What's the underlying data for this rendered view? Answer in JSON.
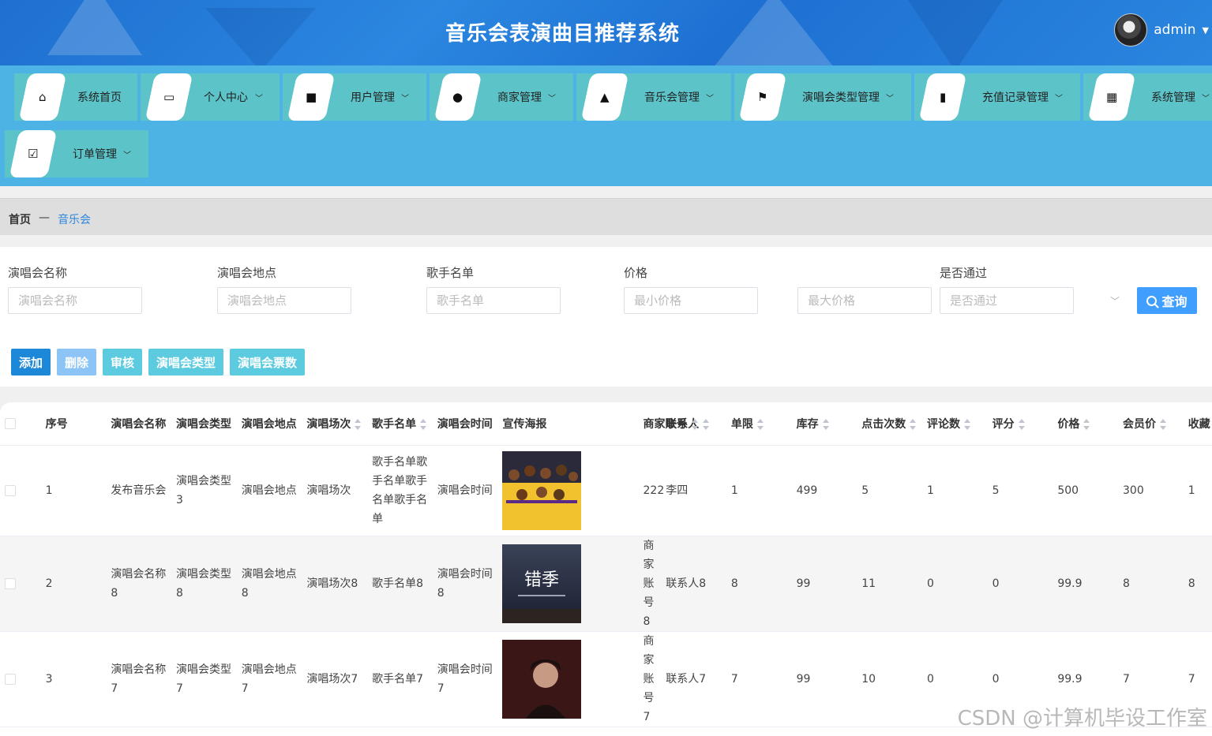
{
  "header": {
    "title": "音乐会表演曲目推荐系统",
    "user": "admin"
  },
  "nav": [
    {
      "label": "系统首页",
      "icon": "home-icon",
      "dropdown": false
    },
    {
      "label": "个人中心",
      "icon": "wallet-icon",
      "dropdown": true
    },
    {
      "label": "用户管理",
      "icon": "robot-icon",
      "dropdown": true
    },
    {
      "label": "商家管理",
      "icon": "user-icon",
      "dropdown": true
    },
    {
      "label": "音乐会管理",
      "icon": "person-icon",
      "dropdown": true
    },
    {
      "label": "演唱会类型管理",
      "icon": "flag-icon",
      "dropdown": true
    },
    {
      "label": "充值记录管理",
      "icon": "bar-chart-icon",
      "dropdown": true
    },
    {
      "label": "系统管理",
      "icon": "grid-icon",
      "dropdown": true
    },
    {
      "label": "订单管理",
      "icon": "clipboard-icon",
      "dropdown": true
    }
  ],
  "breadcrumb": {
    "home": "首页",
    "sep": "—",
    "current": "音乐会"
  },
  "search": {
    "name_label": "演唱会名称",
    "name_placeholder": "演唱会名称",
    "place_label": "演唱会地点",
    "place_placeholder": "演唱会地点",
    "singer_label": "歌手名单",
    "singer_placeholder": "歌手名单",
    "price_label": "价格",
    "min_price_placeholder": "最小价格",
    "max_price_placeholder": "最大价格",
    "pass_label": "是否通过",
    "pass_placeholder": "是否通过",
    "button": "查询"
  },
  "actions": [
    "添加",
    "删除",
    "审核",
    "演唱会类型",
    "演唱会票数"
  ],
  "table": {
    "columns": [
      "序号",
      "演唱会名称",
      "演唱会类型",
      "演唱会地点",
      "演唱场次",
      "歌手名单",
      "演唱会时间",
      "宣传海报",
      "商家账号",
      "联系人",
      "单限",
      "库存",
      "点击次数",
      "评论数",
      "评分",
      "价格",
      "会员价",
      "收藏"
    ],
    "rows": [
      [
        "1",
        "发布音乐会",
        "演唱会类型3",
        "演唱会地点",
        "演唱场次",
        "歌手名单歌手名单歌手名单歌手名单",
        "演唱会时间",
        "",
        "222",
        "李四",
        "1",
        "499",
        "5",
        "1",
        "5",
        "500",
        "300",
        "1"
      ],
      [
        "2",
        "演唱会名称8",
        "演唱会类型8",
        "演唱会地点8",
        "演唱场次8",
        "歌手名单8",
        "演唱会时间8",
        "",
        "商家账号8",
        "联系人8",
        "8",
        "99",
        "11",
        "0",
        "0",
        "99.9",
        "8",
        "8"
      ],
      [
        "3",
        "演唱会名称7",
        "演唱会类型7",
        "演唱会地点7",
        "演唱场次7",
        "歌手名单7",
        "演唱会时间7",
        "",
        "商家账号7",
        "联系人7",
        "7",
        "99",
        "10",
        "0",
        "0",
        "99.9",
        "7",
        "7"
      ]
    ],
    "poster_text": {
      "row2": "错季"
    }
  },
  "watermark": "CSDN @计算机毕设工作室",
  "colors": {
    "primary": "#409eff",
    "nav_bg": "#4db3e4",
    "nav_item": "#5cc4c9",
    "header": "#1f6fd0"
  }
}
